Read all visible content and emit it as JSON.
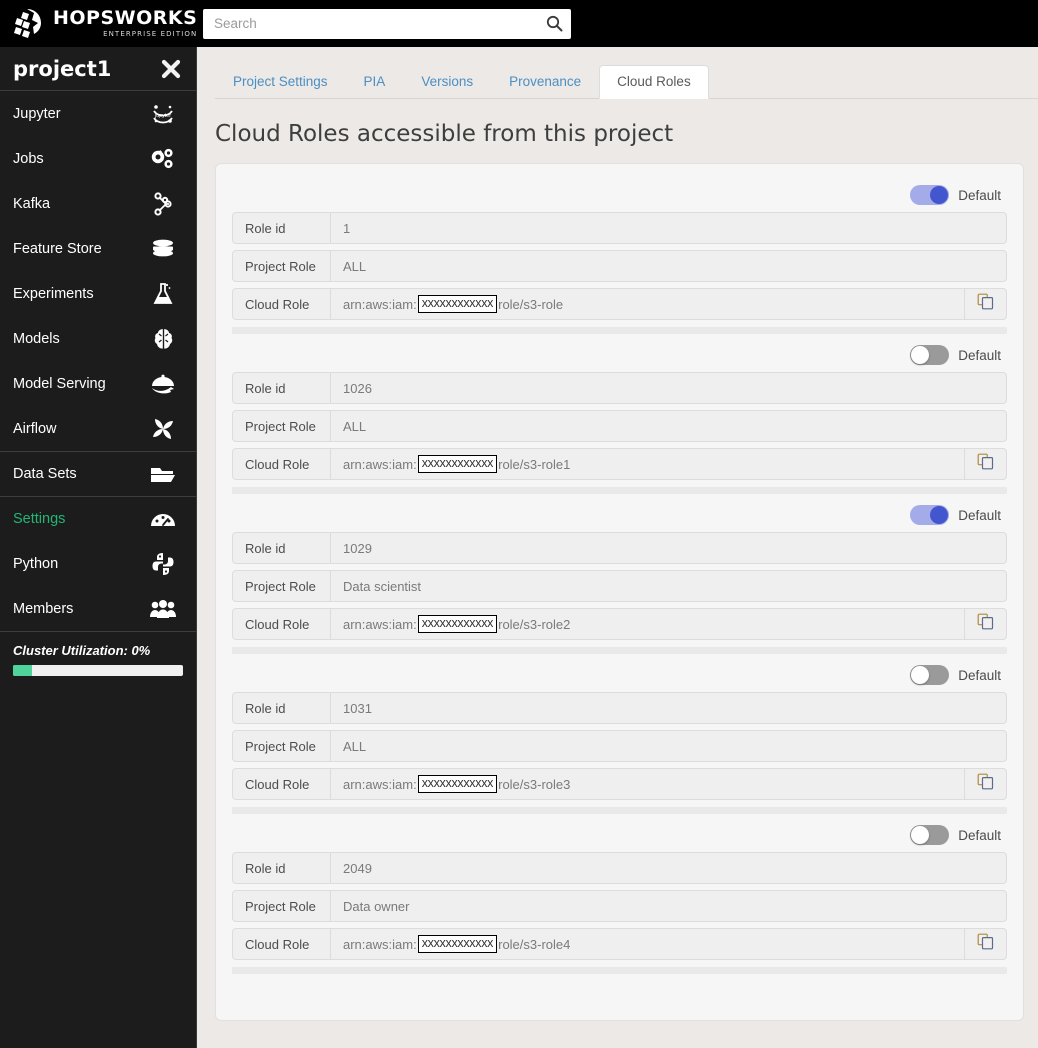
{
  "header": {
    "brand_title": "HOPSWORKS",
    "brand_subtitle": "ENTERPRISE EDITION",
    "brand_logo_icon": "hopsworks-hop-logo-icon",
    "search_placeholder": "Search",
    "search_value": "",
    "search_icon": "search-icon"
  },
  "sidebar": {
    "project_name": "project1",
    "close_icon": "close-x-icon",
    "items": [
      {
        "label": "Jupyter",
        "icon": "jupyter-icon",
        "active": false,
        "separator_above": false
      },
      {
        "label": "Jobs",
        "icon": "gears-icon",
        "active": false,
        "separator_above": false
      },
      {
        "label": "Kafka",
        "icon": "kafka-nodes-icon",
        "active": false,
        "separator_above": false
      },
      {
        "label": "Feature Store",
        "icon": "database-stack-icon",
        "active": false,
        "separator_above": false
      },
      {
        "label": "Experiments",
        "icon": "flask-icon",
        "active": false,
        "separator_above": false
      },
      {
        "label": "Models",
        "icon": "brain-icon",
        "active": false,
        "separator_above": false
      },
      {
        "label": "Model Serving",
        "icon": "serving-dome-icon",
        "active": false,
        "separator_above": false
      },
      {
        "label": "Airflow",
        "icon": "airflow-pinwheel-icon",
        "active": false,
        "separator_above": false
      },
      {
        "label": "Data Sets",
        "icon": "folder-open-icon",
        "active": false,
        "separator_above": true
      },
      {
        "label": "Settings",
        "icon": "gauge-icon",
        "active": true,
        "separator_above": true
      },
      {
        "label": "Python",
        "icon": "python-icon",
        "active": false,
        "separator_above": false
      },
      {
        "label": "Members",
        "icon": "members-group-icon",
        "active": false,
        "separator_above": false
      }
    ],
    "cluster": {
      "label": "Cluster Utilization: 0%",
      "percent": 0
    }
  },
  "tabs": [
    {
      "label": "Project Settings",
      "active": false
    },
    {
      "label": "PIA",
      "active": false
    },
    {
      "label": "Versions",
      "active": false
    },
    {
      "label": "Provenance",
      "active": false
    },
    {
      "label": "Cloud Roles",
      "active": true
    }
  ],
  "page_title": "Cloud Roles accessible from this project",
  "labels": {
    "role_id": "Role id",
    "project_role": "Project Role",
    "cloud_role": "Cloud Role",
    "default_toggle": "Default",
    "copy_icon": "copy-icon"
  },
  "roles": [
    {
      "default_on": true,
      "role_id": "1",
      "project_role": "ALL",
      "arn_prefix": "arn:aws:iam:",
      "arn_mask": "xxxxxxxxxxxx",
      "arn_suffix": "role/s3-role"
    },
    {
      "default_on": false,
      "role_id": "1026",
      "project_role": "ALL",
      "arn_prefix": "arn:aws:iam:",
      "arn_mask": "xxxxxxxxxxxx",
      "arn_suffix": "role/s3-role1"
    },
    {
      "default_on": true,
      "role_id": "1029",
      "project_role": "Data scientist",
      "arn_prefix": "arn:aws:iam:",
      "arn_mask": "xxxxxxxxxxxx",
      "arn_suffix": "role/s3-role2"
    },
    {
      "default_on": false,
      "role_id": "1031",
      "project_role": "ALL",
      "arn_prefix": "arn:aws:iam:",
      "arn_mask": "xxxxxxxxxxxx",
      "arn_suffix": "role/s3-role3"
    },
    {
      "default_on": false,
      "role_id": "2049",
      "project_role": "Data owner",
      "arn_prefix": "arn:aws:iam:",
      "arn_mask": "xxxxxxxxxxxx",
      "arn_suffix": "role/s3-role4"
    }
  ],
  "colors": {
    "topbar_bg": "#000000",
    "sidebar_bg": "#1c1c1c",
    "page_bg": "#ece9e6",
    "panel_bg": "#f6f6f6",
    "active_nav": "#23b574",
    "tab_link": "#4b8fc4",
    "toggle_on_track": "#a3abe8",
    "toggle_on_knob": "#4456cd",
    "toggle_off_track": "#9a9a9a",
    "cluster_fill": "#4fd39a"
  }
}
